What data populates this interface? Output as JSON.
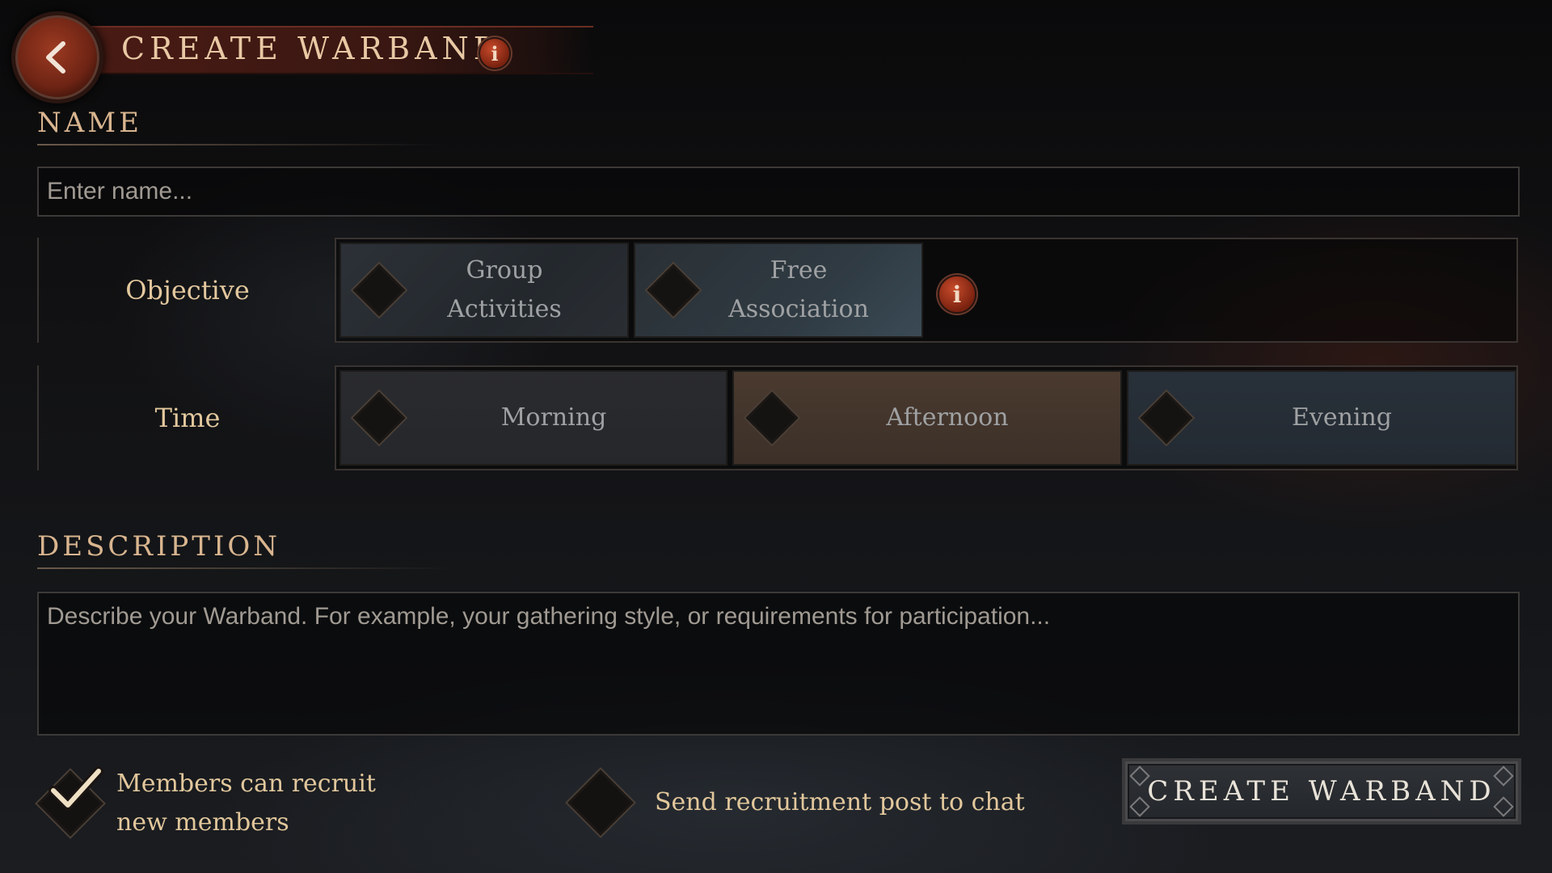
{
  "header": {
    "title": "CREATE WARBAND",
    "back_icon": "chevron-left-icon",
    "info_icon": "info-icon"
  },
  "name_section": {
    "title": "NAME",
    "placeholder": "Enter name...",
    "value": ""
  },
  "objective": {
    "label": "Objective",
    "options": [
      "Group\nActivities",
      "Free\nAssociation"
    ],
    "info_icon": "info-icon"
  },
  "time": {
    "label": "Time",
    "options": [
      "Morning",
      "Afternoon",
      "Evening"
    ]
  },
  "description_section": {
    "title": "DESCRIPTION",
    "placeholder": "Describe your Warband. For example, your gathering style, or requirements for participation...",
    "value": ""
  },
  "options": {
    "recruit_label": "Members can recruit new members",
    "recruit_checked": true,
    "post_label": "Send recruitment post to chat",
    "post_checked": false
  },
  "create_button": {
    "label": "CREATE WARBAND"
  },
  "colors": {
    "accent_gold": "#e3c89e",
    "banner_red": "#4a1b14",
    "info_red": "#c74a2a"
  }
}
